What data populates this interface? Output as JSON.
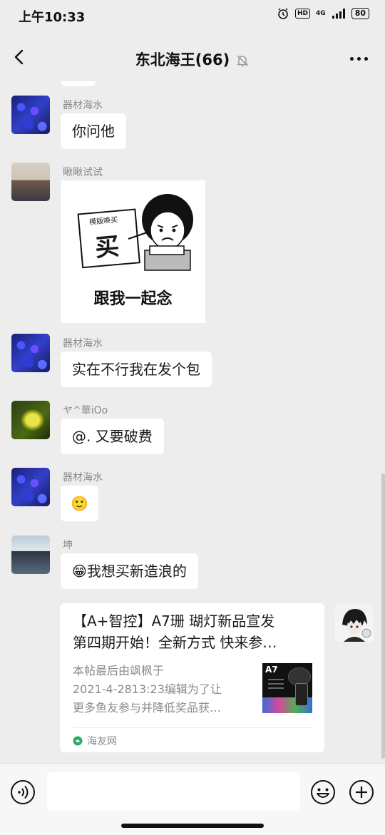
{
  "status_bar": {
    "time": "上午10:33",
    "hd": "HD",
    "network": "4G",
    "battery": "80"
  },
  "header": {
    "title": "东北海王(66)",
    "icons": [
      "back-arrow-icon",
      "mute-bell-icon",
      "more-dots-icon"
    ]
  },
  "messages": [
    {
      "sender": "器材海水",
      "type": "text",
      "text": "你问他",
      "avatar": "reef-avatar"
    },
    {
      "sender": "瞅瞅试试",
      "type": "sticker",
      "avatar": "kids-avatar",
      "sticker": {
        "board_small": "模版唤买",
        "board_big": "买",
        "caption": "跟我一起念"
      }
    },
    {
      "sender": "器材海水",
      "type": "text",
      "text": "实在不行我在发个包",
      "avatar": "reef-avatar"
    },
    {
      "sender": "ヤ^華iOo",
      "type": "text",
      "text": "@. 又要破费",
      "avatar": "fish-avatar"
    },
    {
      "sender": "器材海水",
      "type": "emoji",
      "emoji": "🙂",
      "avatar": "reef-avatar"
    },
    {
      "sender": "坤",
      "type": "text",
      "emoji": "😁",
      "text": "我想买新造浪的",
      "avatar": "man-avatar"
    },
    {
      "sender": "self",
      "type": "link_card",
      "avatar": "anime-avatar",
      "card": {
        "title_line1": "【A+智控】A7珊 瑚灯新品宣发",
        "title_line2": "第四期开始！全新方式  快来参…",
        "desc_line1": "本帖最后由飒枫于",
        "desc_line2": "2021-4-2813:23编辑为了让",
        "desc_line3": "更多鱼友参与并降低奖品获…",
        "thumb_label": "A7",
        "source": "海友网"
      }
    }
  ],
  "input_bar": {
    "icons": [
      "voice-icon",
      "emoji-icon",
      "add-icon"
    ],
    "text": ""
  },
  "colors": {
    "background": "#ededed",
    "bubble": "#ffffff",
    "name_gray": "#8a8a8a",
    "link_green": "#2aae67"
  }
}
